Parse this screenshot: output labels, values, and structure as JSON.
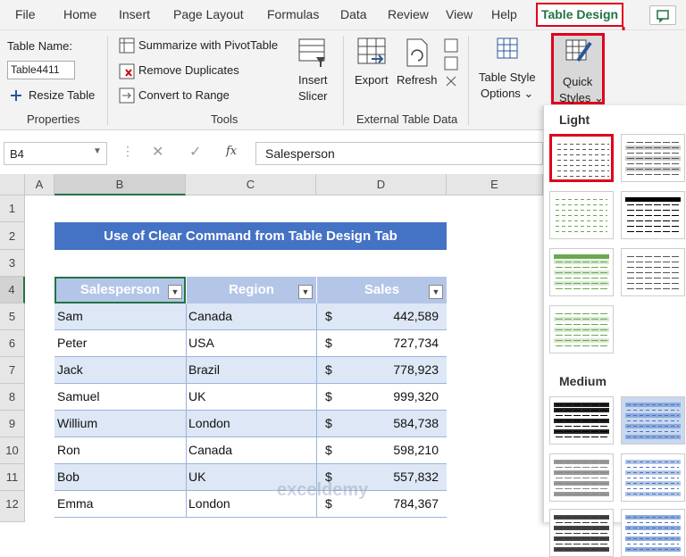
{
  "menu": {
    "tabs": [
      "File",
      "Home",
      "Insert",
      "Page Layout",
      "Formulas",
      "Data",
      "Review",
      "View",
      "Help"
    ],
    "active_tab": "Table Design"
  },
  "ribbon": {
    "table_name_label": "Table Name:",
    "table_name_value": "Table4411",
    "resize": "Resize Table",
    "properties": "Properties",
    "summarize": "Summarize with PivotTable",
    "remove_dup": "Remove Duplicates",
    "convert": "Convert to Range",
    "tools": "Tools",
    "insert_slicer": [
      "Insert",
      "Slicer"
    ],
    "export": "Export",
    "refresh": "Refresh",
    "ext_data": "External Table Data",
    "style_options": [
      "Table Style",
      "Options ⌄"
    ],
    "quick_styles": [
      "Quick",
      "Styles ⌄"
    ]
  },
  "formula": {
    "namebox": "B4",
    "fx": "fx",
    "value": "Salesperson"
  },
  "columns": [
    "A",
    "B",
    "C",
    "D",
    "E"
  ],
  "rows": [
    "1",
    "2",
    "3",
    "4",
    "5",
    "6",
    "7",
    "8",
    "9",
    "10",
    "11",
    "12"
  ],
  "sheet": {
    "title": "Use of Clear Command from Table Design Tab",
    "headers": [
      "Salesperson",
      "Region",
      "Sales"
    ],
    "data": [
      {
        "name": "Sam",
        "region": "Canada",
        "cur": "$",
        "sales": "442,589"
      },
      {
        "name": "Peter",
        "region": "USA",
        "cur": "$",
        "sales": "727,734"
      },
      {
        "name": "Jack",
        "region": "Brazil",
        "cur": "$",
        "sales": "778,923"
      },
      {
        "name": "Samuel",
        "region": "UK",
        "cur": "$",
        "sales": "999,320"
      },
      {
        "name": "Willium",
        "region": "London",
        "cur": "$",
        "sales": "584,738"
      },
      {
        "name": "Ron",
        "region": "Canada",
        "cur": "$",
        "sales": "598,210"
      },
      {
        "name": "Bob",
        "region": "UK",
        "cur": "$",
        "sales": "557,832"
      },
      {
        "name": "Emma",
        "region": "London",
        "cur": "$",
        "sales": "784,367"
      }
    ]
  },
  "gallery": {
    "light": "Light",
    "medium": "Medium"
  },
  "watermark": "exceldemy",
  "colors": {
    "accent": "#217346",
    "highlight": "#e0001b",
    "table_header": "#b4c6e7",
    "band": "#dde7f5",
    "banner": "#4472c4"
  }
}
